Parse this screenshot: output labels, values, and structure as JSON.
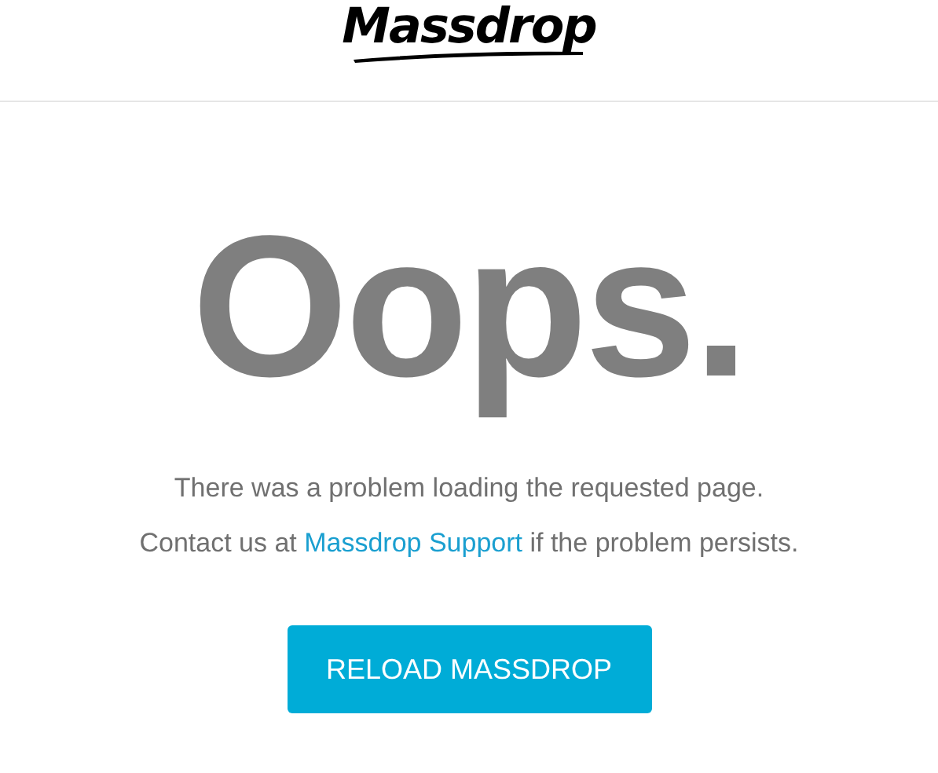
{
  "header": {
    "logo": "Massdrop"
  },
  "headline": "Oops.",
  "message": "There was a problem loading the requested page.",
  "contact": {
    "before": "Contact us at ",
    "link": "Massdrop Support",
    "after": " if the problem persists."
  },
  "button": "RELOAD MASSDROP"
}
